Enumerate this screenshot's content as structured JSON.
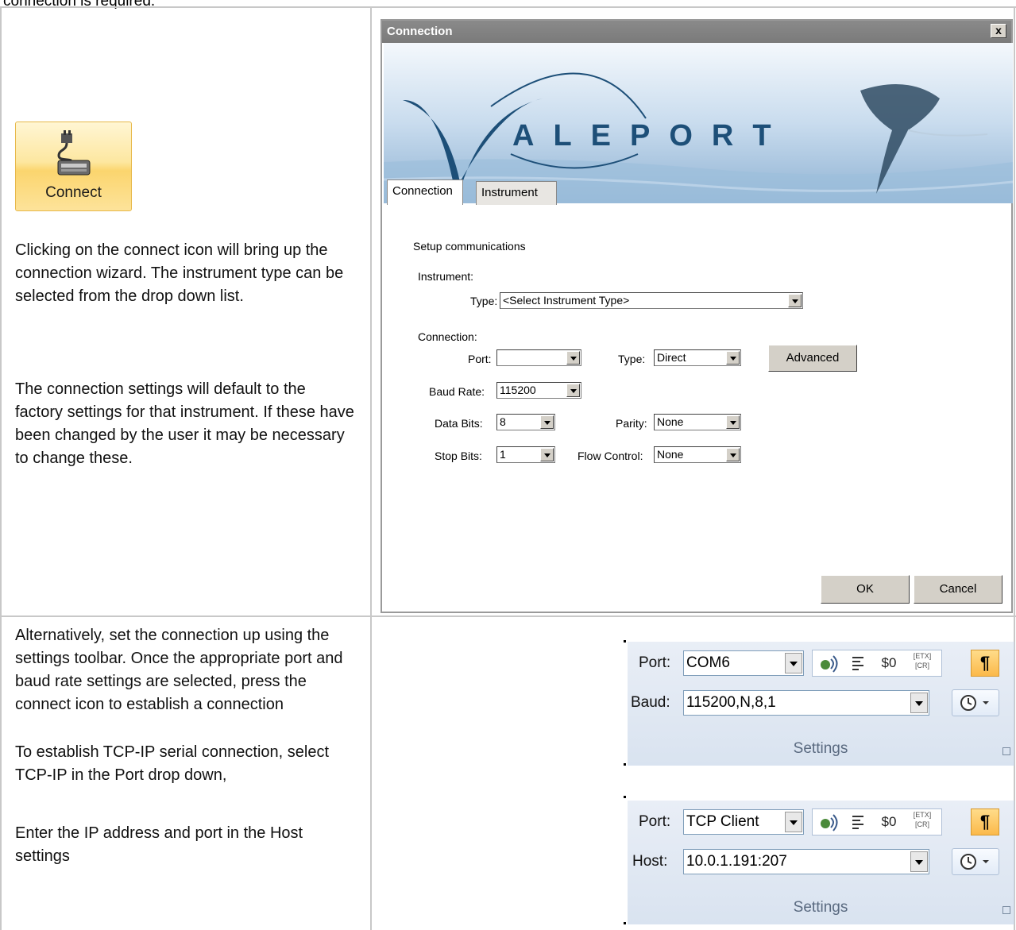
{
  "caption_partial": "connection is required.",
  "connect_button": {
    "label": "Connect"
  },
  "row1": {
    "para1": "Clicking on the connect  icon will bring up the connection wizard. The instrument type can be selected from the drop down list.",
    "para2": "The connection settings will default to the factory settings for that instrument. If these have been changed by the user it may be necessary to change these."
  },
  "dialog": {
    "title": "Connection",
    "close": "x",
    "logo": {
      "v": "V",
      "rest": "ALEPORT"
    },
    "tabs": [
      "Connection",
      "Instrument"
    ],
    "setup": "Setup communications",
    "instrument_label": "Instrument:",
    "type_label": "Type:",
    "type_value": "<Select Instrument Type>",
    "connection_label": "Connection:",
    "port_label": "Port:",
    "port_value": "",
    "conn_type_label": "Type:",
    "conn_type_value": "Direct",
    "advanced": "Advanced",
    "baud_label": "Baud Rate:",
    "baud_value": "115200",
    "databits_label": "Data Bits:",
    "databits_value": "8",
    "parity_label": "Parity:",
    "parity_value": "None",
    "stopbits_label": "Stop Bits:",
    "stopbits_value": "1",
    "flow_label": "Flow Control:",
    "flow_value": "None",
    "ok": "OK",
    "cancel": "Cancel"
  },
  "row2": {
    "para1": "Alternatively, set the connection up using the settings toolbar. Once the appropriate port and baud rate settings are selected, press the connect icon to establish a connection",
    "para2": "To establish TCP-IP serial connection, select TCP-IP in the Port drop down,",
    "para3": "Enter the IP address and port in the Host settings"
  },
  "toolbar1": {
    "port_label": "Port:",
    "port_value": "COM6",
    "second_label": "Baud:",
    "second_value": "115200,N,8,1",
    "group": "Settings",
    "btn_dollar": "$0",
    "btn_etx": "[ETX]",
    "btn_cr": "[CR]",
    "btn_para": "¶"
  },
  "toolbar2": {
    "port_label": "Port:",
    "port_value": "TCP Client",
    "second_label": "Host:",
    "second_value": "10.0.1.191:207",
    "group": "Settings",
    "btn_dollar": "$0",
    "btn_etx": "[ETX]",
    "btn_cr": "[CR]",
    "btn_para": "¶"
  }
}
